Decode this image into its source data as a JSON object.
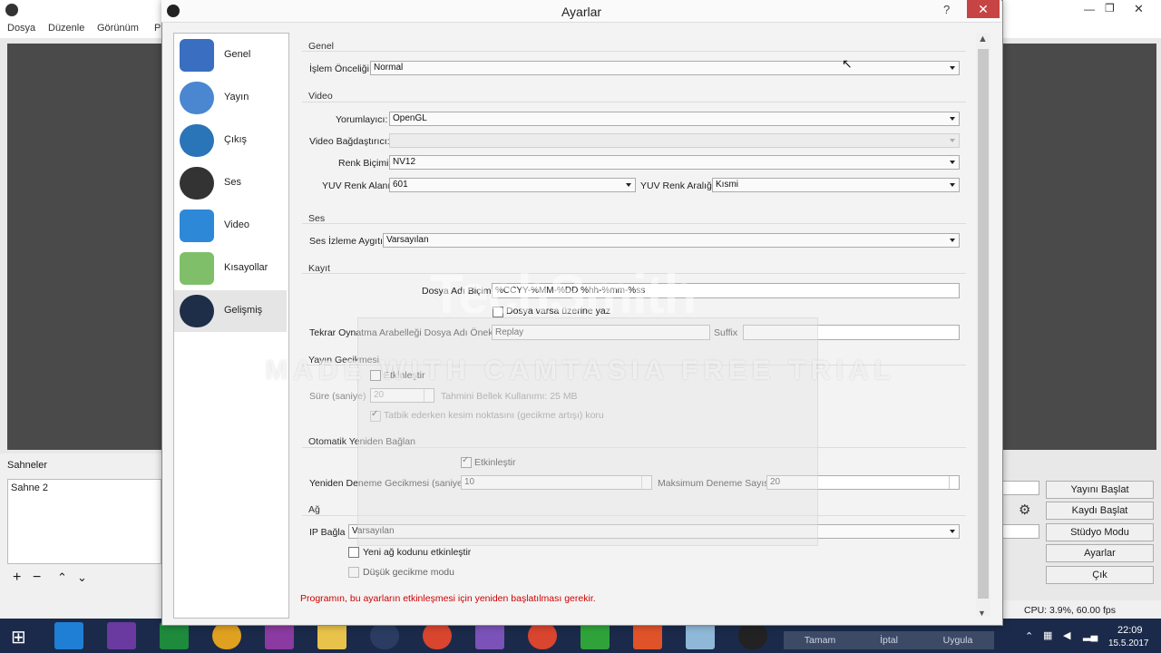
{
  "main_window": {
    "menu": [
      "Dosya",
      "Düzenle",
      "Görünüm",
      "P"
    ],
    "scenes_label": "Sahneler",
    "scenes": [
      "Sahne 2"
    ],
    "buttons": [
      "Yayını Başlat",
      "Kaydı Başlat",
      "Stüdyo Modu",
      "Ayarlar",
      "Çık"
    ],
    "status": "CPU: 3.9%, 60.00 fps"
  },
  "dialog": {
    "title": "Ayarlar",
    "help": "?",
    "close": "✕",
    "nav": [
      {
        "label": "Genel",
        "icon": "general-icon"
      },
      {
        "label": "Yayın",
        "icon": "stream-icon"
      },
      {
        "label": "Çıkış",
        "icon": "output-icon"
      },
      {
        "label": "Ses",
        "icon": "audio-icon"
      },
      {
        "label": "Video",
        "icon": "video-icon"
      },
      {
        "label": "Kısayollar",
        "icon": "hotkeys-icon"
      },
      {
        "label": "Gelişmiş",
        "icon": "advanced-icon",
        "selected": true
      }
    ],
    "general": {
      "section": "Genel",
      "priority_label": "İşlem Önceliği",
      "priority_value": "Normal"
    },
    "video": {
      "section": "Video",
      "renderer_label": "Yorumlayıcı:",
      "renderer_value": "OpenGL",
      "adapter_label": "Video Bağdaştırıcı:",
      "adapter_value": "",
      "color_format_label": "Renk Biçimi",
      "color_format_value": "NV12",
      "yuv_space_label": "YUV Renk Alanı",
      "yuv_space_value": "601",
      "yuv_range_label": "YUV Renk Aralığı",
      "yuv_range_value": "Kısmi"
    },
    "audio": {
      "section": "Ses",
      "monitor_label": "Ses İzleme Aygıtı",
      "monitor_value": "Varsayılan"
    },
    "recording": {
      "section": "Kayıt",
      "filename_label": "Dosya Adı Biçimi",
      "filename_value": "%CCYY-%MM-%DD %hh-%mm-%ss",
      "overwrite_label": "Dosya varsa üzerine yaz",
      "replay_label": "Tekrar Oynatma Arabelleği Dosya Adı Öneki",
      "replay_value": "Replay",
      "suffix_label": "Suffix",
      "suffix_value": ""
    },
    "stream_delay": {
      "section": "Yayın Gecikmesi",
      "enable_label": "Etkinleştir",
      "duration_label": "Süre (saniye)",
      "duration_value": "20",
      "memory_label": "Tahmini Bellek Kullanımı: 25 MB",
      "preserve_label": "Tatbik ederken kesim noktasını (gecikme artışı) koru"
    },
    "reconnect": {
      "section": "Otomatik Yeniden Bağlan",
      "enable_label": "Etkinleştir",
      "retry_delay_label": "Yeniden Deneme Gecikmesi (saniye)",
      "retry_delay_value": "10",
      "max_retries_label": "Maksimum Deneme Sayısı",
      "max_retries_value": "20"
    },
    "network": {
      "section": "Ağ",
      "bind_ip_label": "IP Bağla",
      "bind_ip_value": "Varsayılan",
      "new_net_code_label": "Yeni ağ kodunu etkinleştir",
      "low_latency_label": "Düşük gecikme modu"
    },
    "warning": "Programın, bu ayarların etkinleşmesi için yeniden başlatılması gerekir.",
    "footer_buttons": [
      "Tamam",
      "İptal",
      "Uygula"
    ]
  },
  "watermark": {
    "logo": "TechSmith",
    "text": "MADE WITH CAMTASIA FREE TRIAL"
  },
  "taskbar": {
    "time": "22:09",
    "date": "15.5.2017"
  }
}
